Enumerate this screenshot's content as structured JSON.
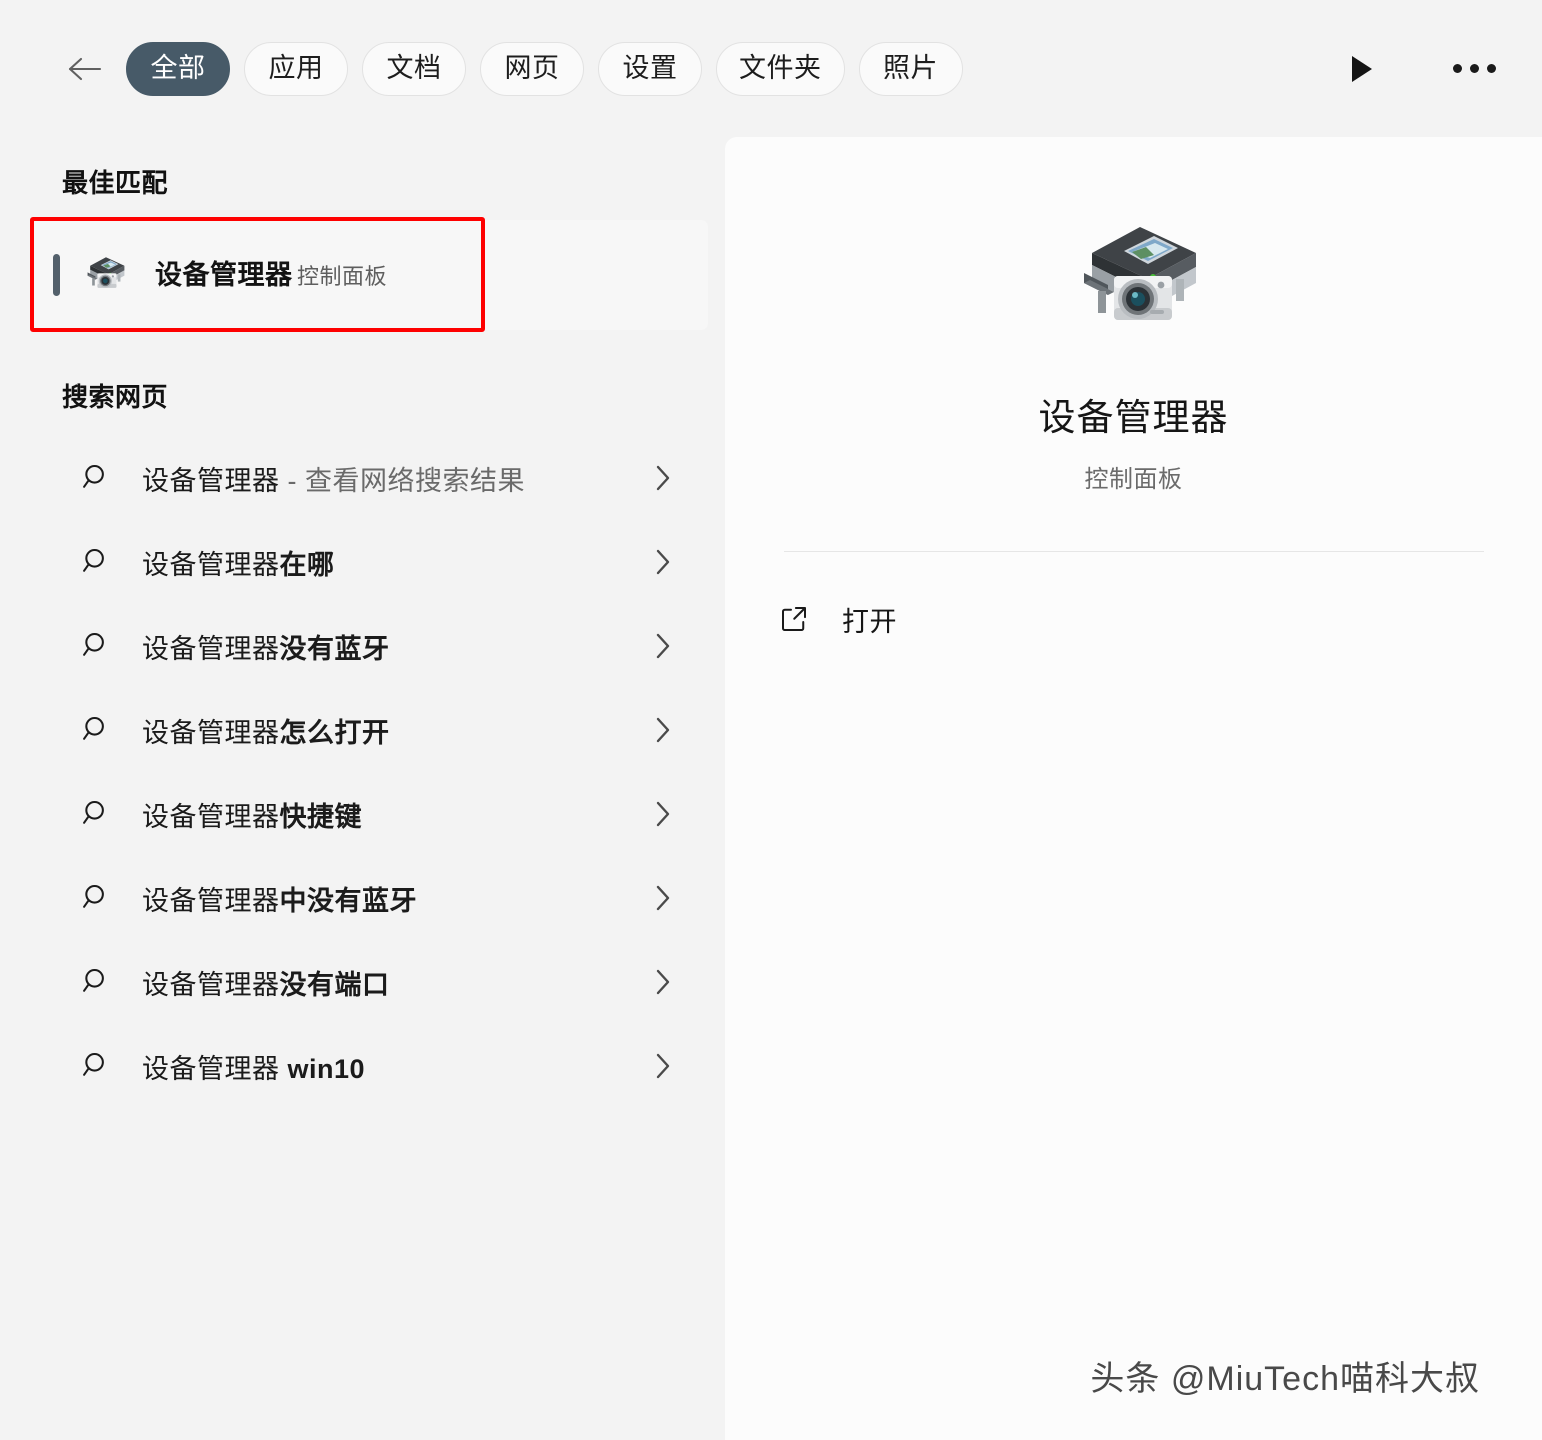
{
  "header": {
    "back_icon": "back-arrow-icon",
    "play_icon": "play-triangle-icon",
    "more_icon": "more-options-icon",
    "active_color": "#475a68",
    "tabs": [
      {
        "label": "全部",
        "active": true
      },
      {
        "label": "应用",
        "active": false
      },
      {
        "label": "文档",
        "active": false
      },
      {
        "label": "网页",
        "active": false
      },
      {
        "label": "设置",
        "active": false
      },
      {
        "label": "文件夹",
        "active": false
      },
      {
        "label": "照片",
        "active": false
      }
    ]
  },
  "results": {
    "best_match_title": "最佳匹配",
    "best_match": {
      "name": "设备管理器",
      "subtitle": "控制面板",
      "icon": "device-manager-icon",
      "selected": true,
      "highlight_color": "#fe0000"
    },
    "web_section_title": "搜索网页",
    "query": "设备管理器",
    "suggestions": [
      {
        "query": "设备管理器",
        "suffix": " - 查看网络搜索结果",
        "suffix_style": "muted",
        "icon": "search-icon",
        "chevron": "chevron-right-icon"
      },
      {
        "query": "设备管理器",
        "suffix": "在哪",
        "suffix_style": "bold",
        "icon": "search-icon",
        "chevron": "chevron-right-icon"
      },
      {
        "query": "设备管理器",
        "suffix": "没有蓝牙",
        "suffix_style": "bold",
        "icon": "search-icon",
        "chevron": "chevron-right-icon"
      },
      {
        "query": "设备管理器",
        "suffix": "怎么打开",
        "suffix_style": "bold",
        "icon": "search-icon",
        "chevron": "chevron-right-icon"
      },
      {
        "query": "设备管理器",
        "suffix": "快捷键",
        "suffix_style": "bold",
        "icon": "search-icon",
        "chevron": "chevron-right-icon"
      },
      {
        "query": "设备管理器",
        "suffix": "中没有蓝牙",
        "suffix_style": "bold",
        "icon": "search-icon",
        "chevron": "chevron-right-icon"
      },
      {
        "query": "设备管理器",
        "suffix": "没有端口",
        "suffix_style": "bold",
        "icon": "search-icon",
        "chevron": "chevron-right-icon"
      },
      {
        "query": "设备管理器",
        "suffix": " win10",
        "suffix_style": "bold",
        "icon": "search-icon",
        "chevron": "chevron-right-icon"
      }
    ]
  },
  "detail": {
    "icon": "device-manager-icon",
    "title": "设备管理器",
    "subtitle": "控制面板",
    "actions": [
      {
        "label": "打开",
        "icon": "external-link-icon"
      }
    ]
  },
  "watermark": {
    "text": "头条 @MiuTech喵科大叔"
  }
}
